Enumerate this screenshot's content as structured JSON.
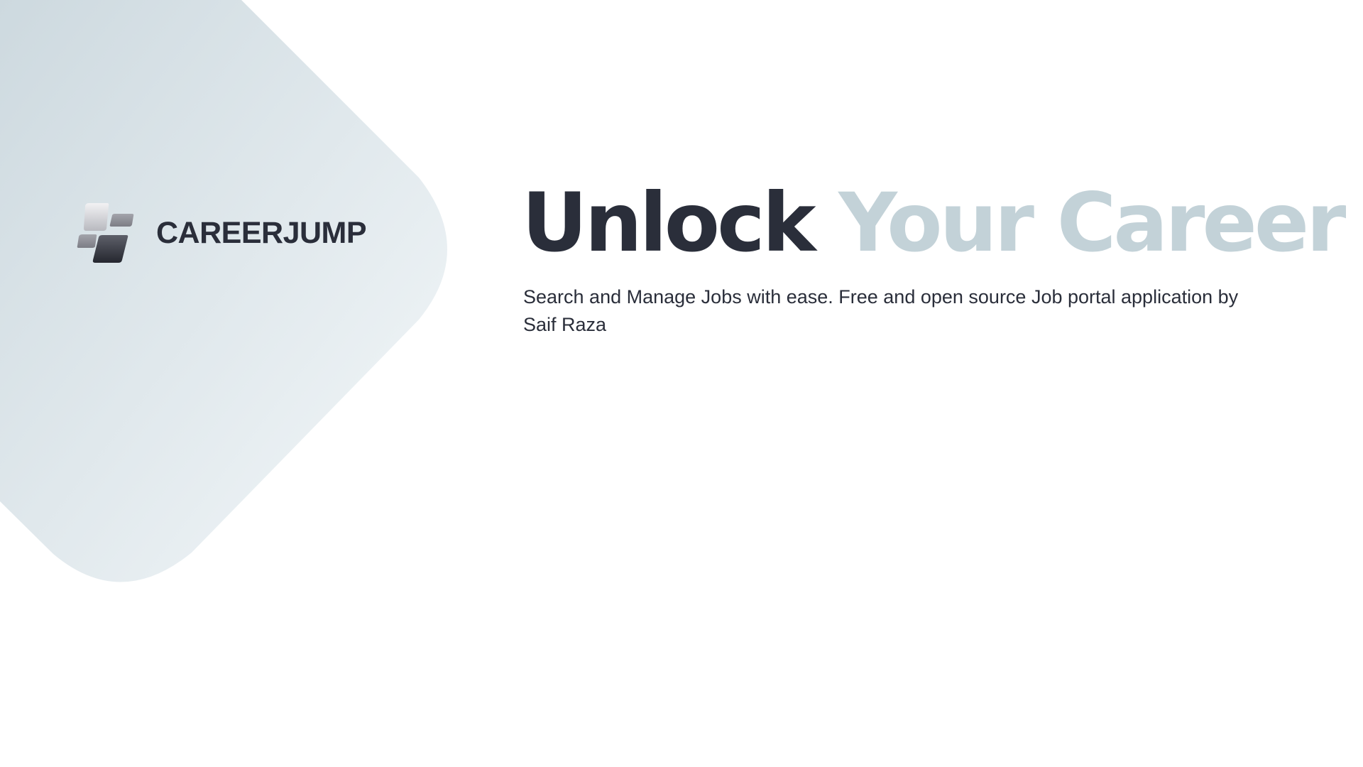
{
  "brand": {
    "name": "CAREERJUMP",
    "logo_icon": "stacked-tiles-logo-icon"
  },
  "hero": {
    "title_dark": "Unlock",
    "title_light": "Your Career",
    "subtitle": "Search and Manage Jobs with ease. Free and open source Job portal application by Saif Raza"
  },
  "colors": {
    "text_dark": "#2a2e3a",
    "text_light": "#c3d2d8",
    "shape_start": "#cdd9df",
    "shape_end": "#f4f8fa",
    "background": "#ffffff"
  }
}
